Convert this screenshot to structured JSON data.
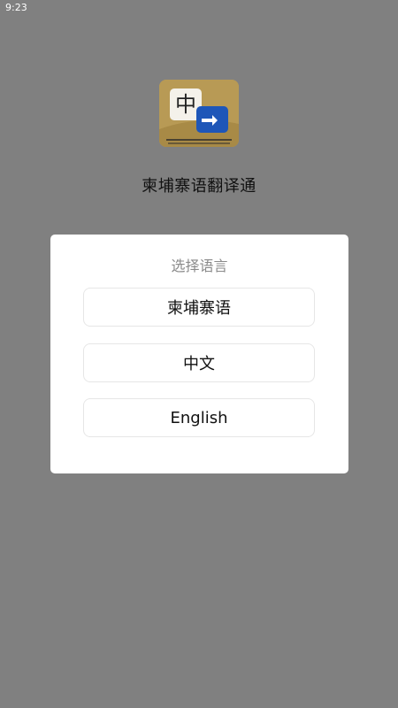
{
  "status_bar": {
    "time": "9:23"
  },
  "app": {
    "logo_icon": "app-logo-icon",
    "logo_glyph": "中",
    "title": "柬埔寨语翻译通"
  },
  "dialog": {
    "title": "选择语言",
    "options": [
      {
        "label": "柬埔寨语"
      },
      {
        "label": "中文"
      },
      {
        "label": "English"
      }
    ]
  },
  "colors": {
    "overlay": "#808080",
    "dialog_bg": "#ffffff",
    "logo_gold": "#b89a55",
    "logo_blue": "#1e56b8"
  }
}
